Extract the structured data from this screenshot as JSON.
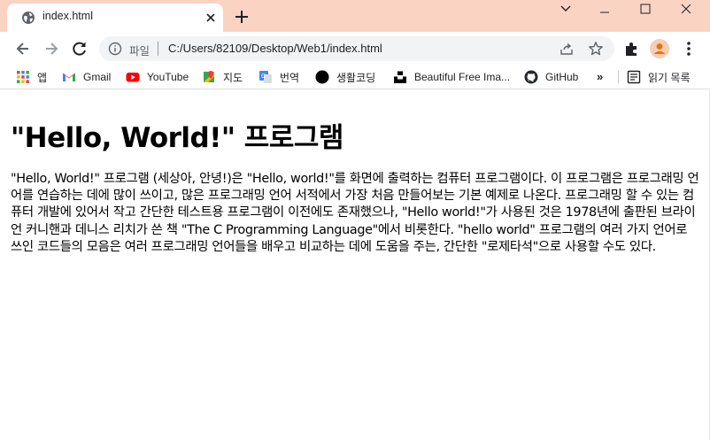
{
  "tab": {
    "title": "index.html"
  },
  "address_bar": {
    "scheme_label": "파일",
    "url": "C:/Users/82109/Desktop/Web1/index.html"
  },
  "bookmarks": [
    {
      "label": "앱",
      "icon": "apps-grid-icon"
    },
    {
      "label": "Gmail",
      "icon": "gmail-icon"
    },
    {
      "label": "YouTube",
      "icon": "youtube-icon"
    },
    {
      "label": "지도",
      "icon": "maps-icon"
    },
    {
      "label": "번역",
      "icon": "translate-icon"
    },
    {
      "label": "생활코딩",
      "icon": "black-circle-icon"
    },
    {
      "label": "Beautiful Free Ima...",
      "icon": "unsplash-icon"
    },
    {
      "label": "GitHub",
      "icon": "github-icon"
    }
  ],
  "bookmarks_overflow": "»",
  "reading_list": {
    "label": "읽기 목록",
    "icon": "reading-list-icon"
  },
  "page": {
    "heading": "\"Hello, World!\" 프로그램",
    "paragraph": "\"Hello, World!\" 프로그램 (세상아, 안녕!)은 \"Hello, world!\"를 화면에 출력하는 컴퓨터 프로그램이다. 이 프로그램은 프로그래밍 언어를 연습하는 데에 많이 쓰이고, 많은 프로그래밍 언어 서적에서 가장 처음 만들어보는 기본 예제로 나온다. 프로그래밍 할 수 있는 컴퓨터 개발에 있어서 작고 간단한 테스트용 프로그램이 이전에도 존재했으나, \"Hello world!\"가 사용된 것은 1978년에 출판된 브라이언 커니핸과 데니스 리치가 쓴 책 \"The C Programming Language\"에서 비롯한다. \"hello world\" 프로그램의 여러 가지 언어로 쓰인 코드들의 모음은 여러 프로그래밍 언어들을 배우고 비교하는 데에 도움을 주는, 간단한 \"로제타석\"으로 사용할 수도 있다."
  },
  "colors": {
    "titlebar": "#fbd3c3",
    "omnibox": "#f1f3f4",
    "accent_profile": "#e8710a"
  }
}
